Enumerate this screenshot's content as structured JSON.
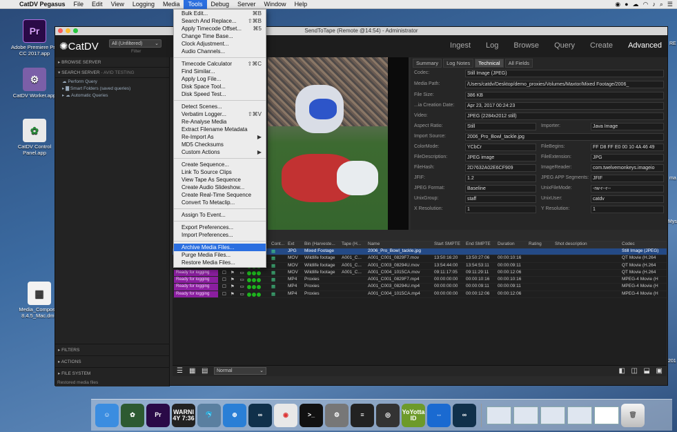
{
  "menubar": {
    "app": "CatDV Pegasus",
    "items": [
      "File",
      "Edit",
      "View",
      "Logging",
      "Media",
      "Tools",
      "Debug",
      "Server",
      "Window",
      "Help"
    ],
    "active": "Tools"
  },
  "desktop_icons": [
    {
      "label": "Adobe Premiere Pro CC 2017.app",
      "glyph": "Pr",
      "color": "#2a0a47"
    },
    {
      "label": "CatDV Worker.app",
      "glyph": "⚙",
      "color": "#7b5fa8"
    },
    {
      "label": "CatDV Control Panel.app",
      "glyph": "✿",
      "color": "#1f3a22"
    },
    {
      "label": "Media_Composer 8.4.5_Mac.dmg",
      "glyph": "▤",
      "color": "#cfcfcf"
    }
  ],
  "desktop_edge_labels": [
    "RE",
    "ma",
    "Mys",
    "201"
  ],
  "window": {
    "title": "SendToTape (Remote @14:54) - Administrator",
    "logo": "CatDV",
    "catalog_select": "All (Unfiltered)",
    "filter_label": "Filter",
    "nav": [
      "Ingest",
      "Log",
      "Browse",
      "Query",
      "Create",
      "Advanced"
    ],
    "nav_active": "Advanced"
  },
  "sidebar": {
    "browse_server": "BROWSE SERVER",
    "search_server": "SEARCH SERVER",
    "search_suffix": "- Avid Testing",
    "items": [
      "Perform Query",
      "Smart Folders (saved queries)",
      "Automatic Queries"
    ],
    "filters": "FILTERS",
    "actions": "ACTIONS",
    "file_system": "FILE SYSTEM",
    "status": "Restored media files"
  },
  "info_tabs": [
    "Summary",
    "Log Notes",
    "Technical",
    "All Fields"
  ],
  "info_tab_active": "Technical",
  "technical": {
    "codec_label": "Codec:",
    "codec": "Still Image (JPEG)",
    "media_path_label": "Media Path:",
    "media_path": "/Users/catdv/Desktop/demo_proxies/Volumes/Maxtor/Mixed Footage/2006_",
    "file_size_label": "File Size:",
    "file_size": "386 KB",
    "creation_label": "...ia Creation Date:",
    "creation": "Apr 23, 2017 00:24:23",
    "video_label": "Video:",
    "video": "JPEG (2284x2012 still)",
    "aspect_label": "Aspect Ratio:",
    "aspect": "Still",
    "importer_label": "Importer:",
    "importer": "Java Image",
    "import_source_label": "Import Source:",
    "import_source": "2006_Pro_Bowl_tackle.jpg",
    "colormode_label": "ColorMode:",
    "colormode": "YCbCr",
    "filebegins_label": "FileBegins:",
    "filebegins": "FF D8 FF E0 00 10 4A 46 49",
    "filedesc_label": "FileDescription:",
    "filedesc": "JPEG image",
    "fileext_label": "FileExtension:",
    "fileext": "JPG",
    "filehash_label": "FileHash:",
    "filehash": "2D7632A02E6CF909",
    "imagereader_label": "ImageReader:",
    "imagereader": "com.twelvemonkeys.imageio",
    "jfif_label": "JFIF:",
    "jfif": "1.2",
    "jpegapp_label": "JPEG APP Segments:",
    "jpegapp": "JFIF",
    "jpegformat_label": "JPEG Format:",
    "jpegformat": "Baseline",
    "unixfilemode_label": "UnixFileMode:",
    "unixfilemode": "-rw-r--r--",
    "unixgroup_label": "UnixGroup:",
    "unixgroup": "staff",
    "unixuser_label": "UnixUser:",
    "unixuser": "catdv",
    "xres_label": "X Resolution:",
    "xres": "1",
    "yres_label": "Y Resolution:",
    "yres": "1"
  },
  "table": {
    "headers": [
      "Cont...",
      "Ext",
      "Bin (Harveste...",
      "Tape (H...",
      "Name",
      "Start SMPTE",
      "End SMPTE",
      "Duration",
      "Rating",
      "Shot description",
      "Codec"
    ],
    "rows": [
      {
        "status": "",
        "ext": "JPG",
        "bin": "Mixed Footage",
        "tape": "",
        "name": "2006_Pro_Bowl_tackle.jpg",
        "start": "",
        "end": "",
        "dur": "",
        "codec": "Still Image (JPEG)"
      },
      {
        "status": "",
        "ext": "MOV",
        "bin": "Wildlife footage",
        "tape": "A001_C...",
        "name": "A001_C001_0829F7.mov",
        "start": "13:50:16:20",
        "end": "13:50:27:06",
        "dur": "00:00:10:16",
        "codec": "QT Movie (H.264"
      },
      {
        "status": "",
        "ext": "MOV",
        "bin": "Wildlife footage",
        "tape": "A001_C...",
        "name": "A001_C003_08294U.mov",
        "start": "13:54:44:00",
        "end": "13:54:53:11",
        "dur": "00:00:09:11",
        "codec": "QT Movie (H.264"
      },
      {
        "status": "Ready for logging",
        "ext": "MOV",
        "bin": "Wildlife footage",
        "tape": "A001_C...",
        "name": "A001_C004_1015CA.mov",
        "start": "09:11:17:05",
        "end": "09:11:29:11",
        "dur": "00:00:12:06",
        "codec": "QT Movie (H.264"
      },
      {
        "status": "Ready for logging",
        "ext": "MP4",
        "bin": "Proxies",
        "tape": "",
        "name": "A001_C001_0829F7.mp4",
        "start": "00:00:00:00",
        "end": "00:00:10:16",
        "dur": "00:00:10:16",
        "codec": "MPEG-4 Movie (H"
      },
      {
        "status": "Ready for logging",
        "ext": "MP4",
        "bin": "Proxies",
        "tape": "",
        "name": "A001_C003_08294U.mp4",
        "start": "00:00:00:00",
        "end": "00:00:09:11",
        "dur": "00:00:09:11",
        "codec": "MPEG-4 Movie (H"
      },
      {
        "status": "Ready for logging",
        "ext": "MP4",
        "bin": "Proxies",
        "tape": "",
        "name": "A001_C004_1015CA.mp4",
        "start": "00:00:00:00",
        "end": "00:00:12:06",
        "dur": "00:00:12:06",
        "codec": "MPEG-4 Movie (H"
      }
    ],
    "view_mode": "Normal"
  },
  "tools_menu": [
    {
      "label": "Bulk Edit...",
      "key": "⌘B"
    },
    {
      "label": "Search And Replace...",
      "key": "⇧⌘B"
    },
    {
      "label": "Apply Timecode Offset...",
      "key": "⌘5"
    },
    {
      "label": "Change Time Base...",
      "key": ""
    },
    {
      "label": "Clock Adjustment...",
      "key": ""
    },
    {
      "label": "Audio Channels...",
      "key": ""
    },
    {
      "sep": true
    },
    {
      "label": "Timecode Calculator",
      "key": "⇧⌘C"
    },
    {
      "label": "Find Similar...",
      "key": ""
    },
    {
      "label": "Apply Log File...",
      "key": ""
    },
    {
      "label": "Disk Space Tool...",
      "key": ""
    },
    {
      "label": "Disk Speed Test...",
      "key": ""
    },
    {
      "sep": true
    },
    {
      "label": "Detect Scenes...",
      "key": ""
    },
    {
      "label": "Verbatim Logger...",
      "key": "⇧⌘V"
    },
    {
      "label": "Re-Analyse Media",
      "key": ""
    },
    {
      "label": "Extract Filename Metadata",
      "key": ""
    },
    {
      "label": "Re-Import As",
      "key": "▶"
    },
    {
      "label": "MD5 Checksums",
      "key": ""
    },
    {
      "label": "Custom Actions",
      "key": "▶"
    },
    {
      "sep": true
    },
    {
      "label": "Create Sequence...",
      "key": ""
    },
    {
      "label": "Link To Source Clips",
      "key": ""
    },
    {
      "label": "View Tape As Sequence",
      "key": ""
    },
    {
      "label": "Create Audio Slideshow...",
      "key": ""
    },
    {
      "label": "Create Real-Time Sequence",
      "key": ""
    },
    {
      "label": "Convert To Metaclip...",
      "key": ""
    },
    {
      "sep": true
    },
    {
      "label": "Assign To Event...",
      "key": ""
    },
    {
      "sep": true
    },
    {
      "label": "Export Preferences...",
      "key": ""
    },
    {
      "label": "Import Preferences...",
      "key": ""
    },
    {
      "sep": true
    },
    {
      "label": "Archive Media Files...",
      "key": "",
      "hi": true
    },
    {
      "label": "Purge Media Files...",
      "key": ""
    },
    {
      "label": "Restore Media Files...",
      "key": ""
    }
  ],
  "dock": [
    {
      "name": "finder-icon",
      "glyph": "☺",
      "color": "#3b8de0"
    },
    {
      "name": "catdv-control-icon",
      "glyph": "✿",
      "color": "#2d5a31"
    },
    {
      "name": "premiere-icon",
      "glyph": "Pr",
      "color": "#2a0a47"
    },
    {
      "name": "console-icon",
      "glyph": "WARNI\n4Y 7:36",
      "color": "#222"
    },
    {
      "name": "mysql-workbench-icon",
      "glyph": "🐬",
      "color": "#5a7fa0"
    },
    {
      "name": "safari-icon",
      "glyph": "⊕",
      "color": "#2a7fd6"
    },
    {
      "name": "catdv-icon",
      "glyph": "∞",
      "color": "#10304a"
    },
    {
      "name": "chrome-icon",
      "glyph": "◉",
      "color": "#e8e8e8"
    },
    {
      "name": "terminal-icon",
      "glyph": ">_",
      "color": "#111"
    },
    {
      "name": "system-prefs-icon",
      "glyph": "⚙",
      "color": "#777"
    },
    {
      "name": "disk-utility-icon",
      "glyph": "≡",
      "color": "#222"
    },
    {
      "name": "video-icon",
      "glyph": "◎",
      "color": "#333"
    },
    {
      "name": "yoyotta-icon",
      "glyph": "YoYotta\nID",
      "color": "#6d9a2a"
    },
    {
      "name": "teamviewer-icon",
      "glyph": "⇔",
      "color": "#1a6ad1"
    },
    {
      "name": "catdv-worker-icon",
      "glyph": "∞",
      "color": "#10304a"
    }
  ]
}
